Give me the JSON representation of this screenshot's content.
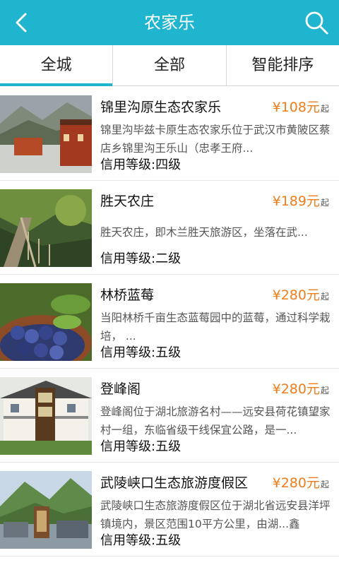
{
  "header": {
    "title": "农家乐",
    "back_icon": "chevron-left-icon",
    "search_icon": "search-icon"
  },
  "tabs": [
    {
      "label": "全城",
      "active": true
    },
    {
      "label": "全部",
      "active": false
    },
    {
      "label": "智能排序",
      "active": false
    }
  ],
  "items": [
    {
      "name": "锦里沟原生态农家乐",
      "price": "¥108元",
      "price_suffix": "起",
      "description": "锦里沟毕兹卡原生态农家乐位于武汉市黄陂区蔡店乡锦里沟王乐山（忠孝王府...",
      "rating": "信用等级:四级"
    },
    {
      "name": "胜天农庄",
      "price": "¥189元",
      "price_suffix": "起",
      "description": "胜天农庄，即木兰胜天旅游区，坐落在武...",
      "rating": "信用等级:二级"
    },
    {
      "name": "林桥蓝莓",
      "price": "¥280元",
      "price_suffix": "起",
      "description": "当阳林桥千亩生态蓝莓园中的蓝莓，通过科学栽培，  ...",
      "rating": "信用等级:五级"
    },
    {
      "name": "登峰阁",
      "price": "¥280元",
      "price_suffix": "起",
      "description": "登峰阁位于湖北旅游名村——远安县荷花镇望家村一组，东临省级干线保宜公路，是一...",
      "rating": "信用等级:五级"
    },
    {
      "name": "武陵峡口生态旅游度假区",
      "price": "¥280元",
      "price_suffix": "起",
      "description": "武陵峡口生态旅游度假区位于湖北省远安县洋坪镇境内，景区范围10平方公里，由湖...鑫",
      "rating": "信用等级:五级"
    }
  ],
  "colors": {
    "accent": "#1fb5cf",
    "price": "#ee7d1b"
  }
}
